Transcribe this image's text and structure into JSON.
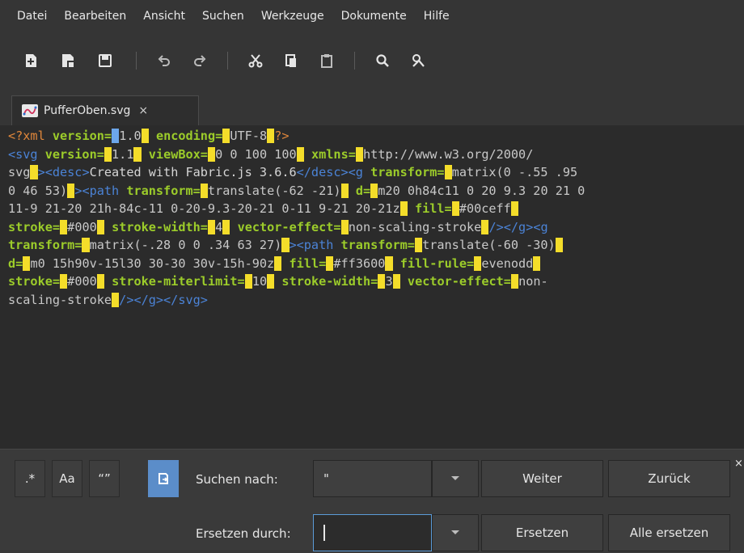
{
  "menu": [
    "Datei",
    "Bearbeiten",
    "Ansicht",
    "Suchen",
    "Werkzeuge",
    "Dokumente",
    "Hilfe"
  ],
  "tab": {
    "title": "PufferOben.svg",
    "close": "×"
  },
  "search": {
    "options": [
      ".*",
      "Aa",
      "“”",
      "⟳"
    ],
    "find_label": "Suchen nach:",
    "find_value": "\"",
    "replace_label": "Ersetzen durch:",
    "replace_value": "",
    "next_label": "Weiter",
    "prev_label": "Zurück",
    "replace_button": "Ersetzen",
    "replace_all_button": "Alle ersetzen",
    "panel_close": "×"
  },
  "colors": {
    "match_highlight": "#f4dd2a",
    "current_match": "#6ca6ea",
    "attribute": "#9ccc2a",
    "tag": "#4b83d6",
    "processing_instruction": "#e0873b",
    "active_option": "#5b8dc9"
  },
  "code_lines": [
    [
      [
        "pi",
        "<?xml "
      ],
      [
        "at",
        "version="
      ],
      [
        "qs",
        "\""
      ],
      [
        "val",
        "1.0"
      ],
      [
        "q",
        "\""
      ],
      [
        "pi",
        " "
      ],
      [
        "at",
        "encoding="
      ],
      [
        "q",
        "\""
      ],
      [
        "val",
        "UTF-8"
      ],
      [
        "q",
        "\""
      ],
      [
        "pi",
        "?>"
      ]
    ],
    [
      [
        "tg",
        "<svg "
      ],
      [
        "at",
        "version="
      ],
      [
        "q",
        "\""
      ],
      [
        "val",
        "1.1"
      ],
      [
        "q",
        "\""
      ],
      [
        "tg",
        " "
      ],
      [
        "at",
        "viewBox="
      ],
      [
        "q",
        "\""
      ],
      [
        "val",
        "0 0 100 100"
      ],
      [
        "q",
        "\""
      ],
      [
        "tg",
        " "
      ],
      [
        "at",
        "xmlns="
      ],
      [
        "q",
        "\""
      ],
      [
        "val",
        "http://www.w3.org/2000/"
      ]
    ],
    [
      [
        "val",
        "svg"
      ],
      [
        "q",
        "\""
      ],
      [
        "tg",
        "><desc>"
      ],
      [
        "txt",
        "Created with Fabric.js 3.6.6"
      ],
      [
        "tg",
        "</desc><g "
      ],
      [
        "at",
        "transform="
      ],
      [
        "q",
        "\""
      ],
      [
        "val",
        "matrix(0 -.55 .95"
      ]
    ],
    [
      [
        "val",
        "0 46 53)"
      ],
      [
        "q",
        "\""
      ],
      [
        "tg",
        "><path "
      ],
      [
        "at",
        "transform="
      ],
      [
        "q",
        "\""
      ],
      [
        "val",
        "translate(-62 -21)"
      ],
      [
        "q",
        "\""
      ],
      [
        "tg",
        " "
      ],
      [
        "at",
        "d="
      ],
      [
        "q",
        "\""
      ],
      [
        "val",
        "m20 0h84c11 0 20 9.3 20 21 0"
      ]
    ],
    [
      [
        "val",
        "11-9 21-20 21h-84c-11 0-20-9.3-20-21 0-11 9-21 20-21z"
      ],
      [
        "q",
        "\""
      ],
      [
        "tg",
        " "
      ],
      [
        "at",
        "fill="
      ],
      [
        "q",
        "\""
      ],
      [
        "val",
        "#00ceff"
      ],
      [
        "q",
        "\""
      ]
    ],
    [
      [
        "at",
        "stroke="
      ],
      [
        "q",
        "\""
      ],
      [
        "val",
        "#000"
      ],
      [
        "q",
        "\""
      ],
      [
        "tg",
        " "
      ],
      [
        "at",
        "stroke-width="
      ],
      [
        "q",
        "\""
      ],
      [
        "val",
        "4"
      ],
      [
        "q",
        "\""
      ],
      [
        "tg",
        " "
      ],
      [
        "at",
        "vector-effect="
      ],
      [
        "q",
        "\""
      ],
      [
        "val",
        "non-scaling-stroke"
      ],
      [
        "q",
        "\""
      ],
      [
        "tg",
        "/></g><g"
      ]
    ],
    [
      [
        "at",
        "transform="
      ],
      [
        "q",
        "\""
      ],
      [
        "val",
        "matrix(-.28 0 0 .34 63 27)"
      ],
      [
        "q",
        "\""
      ],
      [
        "tg",
        "><path "
      ],
      [
        "at",
        "transform="
      ],
      [
        "q",
        "\""
      ],
      [
        "val",
        "translate(-60 -30)"
      ],
      [
        "q",
        "\""
      ]
    ],
    [
      [
        "at",
        "d="
      ],
      [
        "q",
        "\""
      ],
      [
        "val",
        "m0 15h90v-15l30 30-30 30v-15h-90z"
      ],
      [
        "q",
        "\""
      ],
      [
        "tg",
        " "
      ],
      [
        "at",
        "fill="
      ],
      [
        "q",
        "\""
      ],
      [
        "val",
        "#ff3600"
      ],
      [
        "q",
        "\""
      ],
      [
        "tg",
        " "
      ],
      [
        "at",
        "fill-rule="
      ],
      [
        "q",
        "\""
      ],
      [
        "val",
        "evenodd"
      ],
      [
        "q",
        "\""
      ]
    ],
    [
      [
        "at",
        "stroke="
      ],
      [
        "q",
        "\""
      ],
      [
        "val",
        "#000"
      ],
      [
        "q",
        "\""
      ],
      [
        "tg",
        " "
      ],
      [
        "at",
        "stroke-miterlimit="
      ],
      [
        "q",
        "\""
      ],
      [
        "val",
        "10"
      ],
      [
        "q",
        "\""
      ],
      [
        "tg",
        " "
      ],
      [
        "at",
        "stroke-width="
      ],
      [
        "q",
        "\""
      ],
      [
        "val",
        "3"
      ],
      [
        "q",
        "\""
      ],
      [
        "tg",
        " "
      ],
      [
        "at",
        "vector-effect="
      ],
      [
        "q",
        "\""
      ],
      [
        "val",
        "non-"
      ]
    ],
    [
      [
        "val",
        "scaling-stroke"
      ],
      [
        "q",
        "\""
      ],
      [
        "tg",
        "/></g></svg>"
      ]
    ]
  ]
}
